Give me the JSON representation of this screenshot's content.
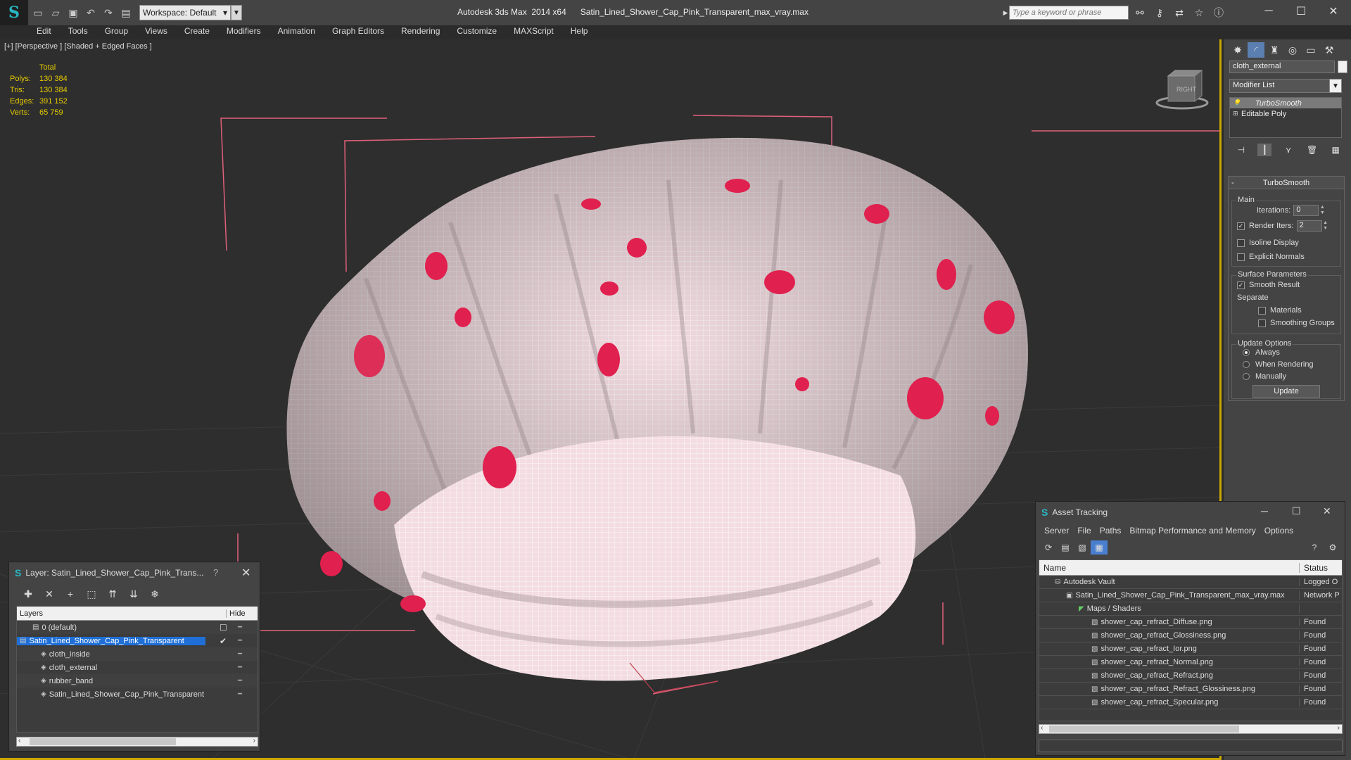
{
  "titlebar": {
    "app_logo": "S",
    "workspace": "Workspace: Default",
    "window_title": "Autodesk 3ds Max  2014 x64      Satin_Lined_Shower_Cap_Pink_Transparent_max_vray.max",
    "search_placeholder": "Type a keyword or phrase"
  },
  "menu": [
    "Edit",
    "Tools",
    "Group",
    "Views",
    "Create",
    "Modifiers",
    "Animation",
    "Graph Editors",
    "Rendering",
    "Customize",
    "MAXScript",
    "Help"
  ],
  "viewport": {
    "label": "[+] [Perspective ] [Shaded + Edged Faces ]",
    "stats_header": "Total",
    "stats": [
      {
        "label": "Polys:",
        "value": "130 384"
      },
      {
        "label": "Tris:",
        "value": "130 384"
      },
      {
        "label": "Edges:",
        "value": "391 152"
      },
      {
        "label": "Verts:",
        "value": "65 759"
      }
    ],
    "viewcube_label": "RIGHT",
    "colors": {
      "background": "#2e2e2e",
      "mesh": "#f3dde2",
      "wire": "#ffffff",
      "spots": "#e0204e",
      "bbox": "#e0607a",
      "active_border": "#c9a600"
    }
  },
  "command_panel": {
    "object_name": "cloth_external",
    "modifier_list": "Modifier List",
    "stack": [
      {
        "label": "TurboSmooth",
        "selected": true
      },
      {
        "label": "Editable Poly",
        "selected": false
      }
    ],
    "rollout_title": "TurboSmooth",
    "main_group": "Main",
    "iterations_label": "Iterations:",
    "iterations_value": "0",
    "render_iters_label": "Render Iters:",
    "render_iters_value": "2",
    "isoline_label": "Isoline Display",
    "explicit_normals_label": "Explicit Normals",
    "surface_group": "Surface Parameters",
    "smooth_result_label": "Smooth Result",
    "separate_label": "Separate",
    "materials_label": "Materials",
    "smoothing_groups_label": "Smoothing Groups",
    "update_group": "Update Options",
    "always_label": "Always",
    "when_rendering_label": "When Rendering",
    "manually_label": "Manually",
    "update_button": "Update"
  },
  "layer_window": {
    "title": "Layer: Satin_Lined_Shower_Cap_Pink_Trans...",
    "help": "?",
    "col_layers": "Layers",
    "col_hide": "Hide",
    "rows": [
      {
        "name": "0 (default)",
        "indent": 0,
        "selected": false
      },
      {
        "name": "Satin_Lined_Shower_Cap_Pink_Transparent",
        "indent": 0,
        "selected": true
      },
      {
        "name": "cloth_inside",
        "indent": 1,
        "selected": false
      },
      {
        "name": "cloth_external",
        "indent": 1,
        "selected": false
      },
      {
        "name": "rubber_band",
        "indent": 1,
        "selected": false
      },
      {
        "name": "Satin_Lined_Shower_Cap_Pink_Transparent",
        "indent": 1,
        "selected": false
      }
    ]
  },
  "asset_window": {
    "title": "Asset Tracking",
    "menu": [
      "Server",
      "File",
      "Paths",
      "Bitmap Performance and Memory",
      "Options"
    ],
    "col_name": "Name",
    "col_status": "Status",
    "rows": [
      {
        "name": "Autodesk Vault",
        "status": "Logged O",
        "indent": 1
      },
      {
        "name": "Satin_Lined_Shower_Cap_Pink_Transparent_max_vray.max",
        "status": "Network P",
        "indent": 2
      },
      {
        "name": "Maps / Shaders",
        "status": "",
        "indent": 3
      },
      {
        "name": "shower_cap_refract_Diffuse.png",
        "status": "Found",
        "indent": 4
      },
      {
        "name": "shower_cap_refract_Glossiness.png",
        "status": "Found",
        "indent": 4
      },
      {
        "name": "shower_cap_refract_Ior.png",
        "status": "Found",
        "indent": 4
      },
      {
        "name": "shower_cap_refract_Normal.png",
        "status": "Found",
        "indent": 4
      },
      {
        "name": "shower_cap_refract_Refract.png",
        "status": "Found",
        "indent": 4
      },
      {
        "name": "shower_cap_refract_Refract_Glossiness.png",
        "status": "Found",
        "indent": 4
      },
      {
        "name": "shower_cap_refract_Specular.png",
        "status": "Found",
        "indent": 4
      }
    ]
  }
}
